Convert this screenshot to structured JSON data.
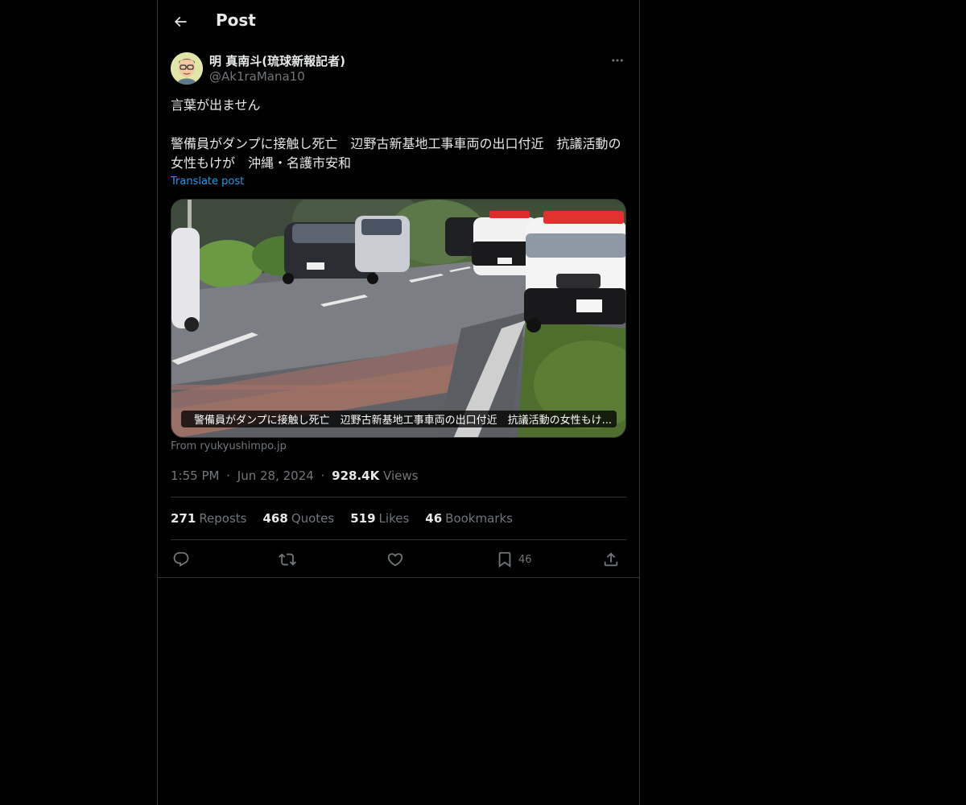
{
  "colors": {
    "background": "#000000",
    "text": "#e7e9ea",
    "secondary": "#71767b",
    "accent": "#1d9bf0",
    "border": "#2f3336"
  },
  "header": {
    "title": "Post",
    "back_icon": "arrow-left-icon"
  },
  "post": {
    "author": {
      "display_name": "明 真南斗(琉球新報記者)",
      "handle": "@Ak1raMana10",
      "avatar_icon": "avatar-illustration"
    },
    "more_icon": "ellipsis-icon",
    "text": {
      "line1": "言葉が出ません",
      "line2": "警備員がダンプに接触し死亡　辺野古新基地工事車両の出口付近　抗議活動の女性もけが　沖縄・名護市安和"
    },
    "translate_label": "Translate post",
    "link_card": {
      "caption": "警備員がダンプに接触し死亡　辺野古新基地工事車両の出口付近　抗議活動の女性もけ...",
      "source": "From ryukyushimpo.jp"
    },
    "meta": {
      "time": "1:55 PM",
      "separator": "·",
      "date": "Jun 28, 2024",
      "views_count": "928.4K",
      "views_label": "Views"
    },
    "stats": {
      "reposts_count": "271",
      "reposts_label": "Reposts",
      "quotes_count": "468",
      "quotes_label": "Quotes",
      "likes_count": "519",
      "likes_label": "Likes",
      "bookmarks_count": "46",
      "bookmarks_label": "Bookmarks"
    },
    "actions": {
      "reply_icon": "reply-icon",
      "repost_icon": "repost-icon",
      "like_icon": "heart-icon",
      "bookmark_icon": "bookmark-icon",
      "bookmark_count": "46",
      "share_icon": "share-icon"
    }
  }
}
